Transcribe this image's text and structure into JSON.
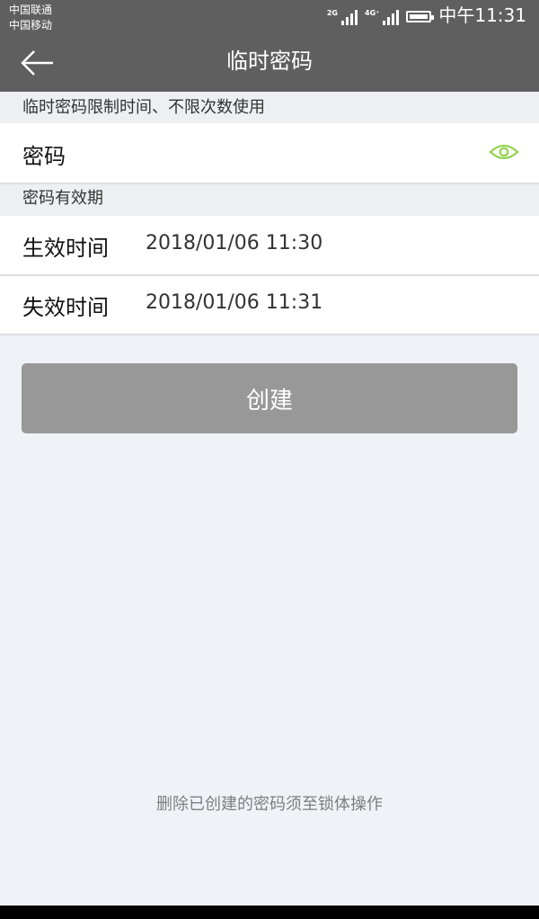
{
  "status_bar": {
    "carrier_1": "中国联通",
    "carrier_2": "中国移动",
    "signal_1_tag": "2G",
    "signal_2_tag": "4G⁺",
    "time": "中午11:31"
  },
  "header": {
    "title": "临时密码"
  },
  "password_section": {
    "hint": "临时密码限制时间、不限次数使用",
    "password_label": "密码"
  },
  "validity_section": {
    "header": "密码有效期",
    "start_label": "生效时间",
    "start_value": "2018/01/06 11:30",
    "end_label": "失效时间",
    "end_value": "2018/01/06 11:31"
  },
  "actions": {
    "create_label": "创建"
  },
  "footer": {
    "note": "删除已创建的密码须至锁体操作"
  },
  "colors": {
    "header_bg": "#5f5f5f",
    "eye_icon": "#8fd14f",
    "button_disabled": "#989898",
    "page_bg": "#eff2f7"
  }
}
